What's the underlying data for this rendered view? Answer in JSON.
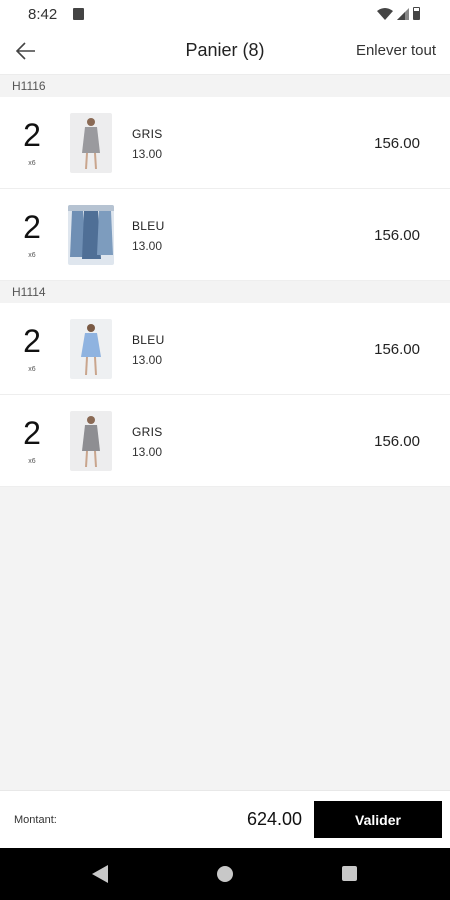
{
  "status_bar": {
    "time": "8:42"
  },
  "app_bar": {
    "title": "Panier (8)",
    "clear_all": "Enlever tout"
  },
  "groups": [
    {
      "code": "H1116",
      "items": [
        {
          "qty": "2",
          "unit": "x6",
          "color": "GRIS",
          "price": "13.00",
          "total": "156.00",
          "thumb": "dress-grey-icon"
        },
        {
          "qty": "2",
          "unit": "x6",
          "color": "BLEU",
          "price": "13.00",
          "total": "156.00",
          "thumb": "dresses-hanging-icon"
        }
      ]
    },
    {
      "code": "H1114",
      "items": [
        {
          "qty": "2",
          "unit": "x6",
          "color": "BLEU",
          "price": "13.00",
          "total": "156.00",
          "thumb": "dress-blue-icon"
        },
        {
          "qty": "2",
          "unit": "x6",
          "color": "GRIS",
          "price": "13.00",
          "total": "156.00",
          "thumb": "dress-grey-icon"
        }
      ]
    }
  ],
  "footer": {
    "amount_label": "Montant:",
    "amount_value": "624.00",
    "validate_label": "Valider"
  },
  "colors": {
    "accent": "#000000",
    "background": "#f3f3f3",
    "surface": "#ffffff"
  }
}
